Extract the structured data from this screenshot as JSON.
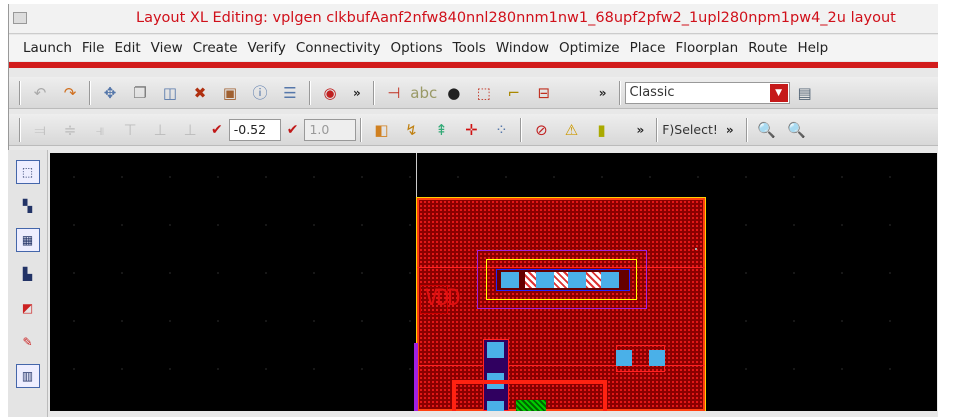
{
  "window": {
    "title": "Layout XL Editing: vplgen clkbufAanf2nfw840nnl280nnm1nw1_68upf2pfw2_1upl280npm1pw4_2u layout"
  },
  "menubar": {
    "items": [
      "Launch",
      "File",
      "Edit",
      "View",
      "Create",
      "Verify",
      "Connectivity",
      "Options",
      "Tools",
      "Window",
      "Optimize",
      "Place",
      "Floorplan",
      "Route",
      "Help"
    ]
  },
  "toolbar1": {
    "icons": [
      "undo-icon",
      "redo-icon",
      "move-icon",
      "copy-icon",
      "stretch-icon",
      "delete-icon",
      "properties-icon",
      "info-icon",
      "align-icon",
      "save-icon",
      "create-instance-icon",
      "create-label-icon",
      "create-pin-icon",
      "select-icon",
      "create-wire-icon",
      "probe-icon"
    ],
    "more": "»",
    "workspace": "Classic"
  },
  "toolbar2": {
    "offset_value": "-0.52",
    "scale_value": "1.0",
    "more": "»",
    "select_label": "F)Select!",
    "more2": "»"
  },
  "canvas": {
    "label": "VDD"
  },
  "colors": {
    "accent": "#d21c1c",
    "title": "#d0101a"
  }
}
